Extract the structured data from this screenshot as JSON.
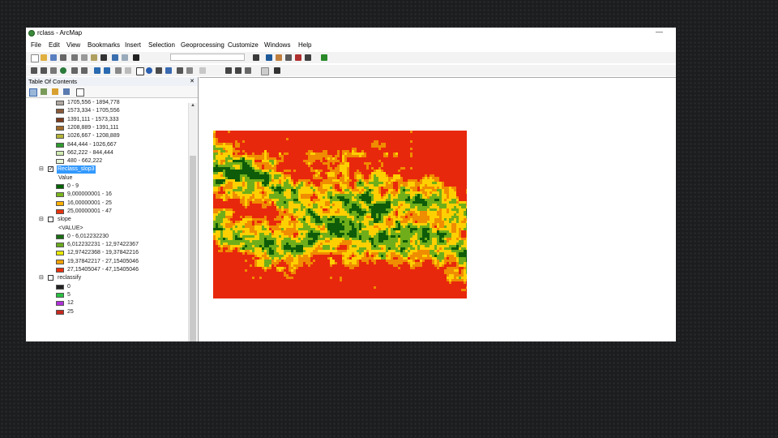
{
  "window": {
    "title": "rclass - ArcMap"
  },
  "menu": [
    "File",
    "Edit",
    "View",
    "Bookmarks",
    "Insert",
    "Selection",
    "Geoprocessing",
    "Customize",
    "Windows",
    "Help"
  ],
  "toc": {
    "title": "Table Of Contents",
    "header_controls": "✕",
    "top_legend": [
      {
        "label": "1705,556 - 1894,778",
        "color": "#b0a8a0"
      },
      {
        "label": "1573,334 - 1705,556",
        "color": "#8a5a3a"
      },
      {
        "label": "1391,111 - 1573,333",
        "color": "#7a3a1e"
      },
      {
        "label": "1208,889 - 1391,111",
        "color": "#a06a2a"
      },
      {
        "label": "1026,667 - 1208,889",
        "color": "#b5b53a"
      },
      {
        "label": "844,444 - 1026,667",
        "color": "#2e9a2e"
      },
      {
        "label": "662,222 - 844,444",
        "color": "#cfeab0"
      },
      {
        "label": "480 - 662,222",
        "color": "#e6f5d8"
      }
    ],
    "layers": [
      {
        "name": "Reclass_slop3",
        "checked": true,
        "selected": true,
        "field": "Value",
        "classes": [
          {
            "label": "0 - 9",
            "color": "#006400"
          },
          {
            "label": "9,000000001 - 16",
            "color": "#7ab51d"
          },
          {
            "label": "16,00000001 - 25",
            "color": "#ffb000"
          },
          {
            "label": "25,00000001 - 47",
            "color": "#e8340f"
          }
        ]
      },
      {
        "name": "slope",
        "checked": false,
        "selected": false,
        "field": "<VALUE>",
        "classes": [
          {
            "label": "0 - 6,012232230",
            "color": "#1a6e14"
          },
          {
            "label": "6,012232231 - 12,97422367",
            "color": "#6aaa1e"
          },
          {
            "label": "12,97422368 - 19,37842216",
            "color": "#e8e800"
          },
          {
            "label": "19,37842217 - 27,15405046",
            "color": "#f0a000"
          },
          {
            "label": "27,15405047 - 47,15405046",
            "color": "#e83010"
          }
        ]
      },
      {
        "name": "reclassify",
        "checked": false,
        "selected": false,
        "field": "",
        "classes": [
          {
            "label": "0",
            "color": "#222222"
          },
          {
            "label": "5",
            "color": "#28c040"
          },
          {
            "label": "12",
            "color": "#b030d8"
          },
          {
            "label": "25",
            "color": "#c8281e"
          }
        ]
      }
    ]
  },
  "map": {
    "palette": [
      "#0e5c0a",
      "#6fae1a",
      "#ffd000",
      "#f08c00",
      "#e8280c"
    ]
  }
}
